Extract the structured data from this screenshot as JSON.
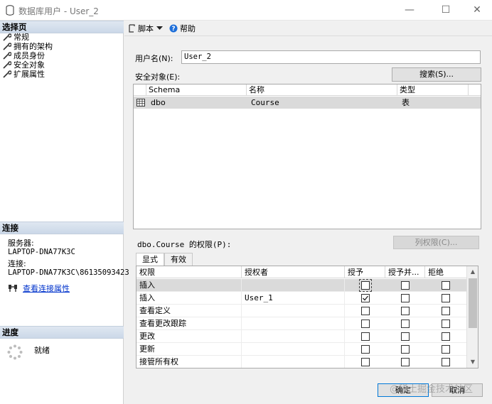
{
  "window": {
    "title": "数据库用户 - User_2",
    "min_icon": "—",
    "max_icon": "☐",
    "close_icon": "✕"
  },
  "left": {
    "select_page_header": "选择页",
    "pages": [
      "常规",
      "拥有的架构",
      "成员身份",
      "安全对象",
      "扩展属性"
    ],
    "connection_header": "连接",
    "server_label": "服务器:",
    "server_value": "LAPTOP-DNA77K3C",
    "connection_label": "连接:",
    "connection_value": "LAPTOP-DNA77K3C\\86135093423",
    "view_connection_link": "查看连接属性",
    "progress_header": "进度",
    "progress_status": "就绪"
  },
  "toolbar": {
    "script_label": "脚本",
    "help_label": "帮助"
  },
  "main": {
    "username_label": "用户名(N):",
    "username_value": "User_2",
    "securables_label": "安全对象(E):",
    "search_button": "搜索(S)...",
    "securables_columns": [
      "Schema",
      "名称",
      "类型"
    ],
    "securables_rows": [
      {
        "schema": "dbo",
        "name": "Course",
        "type": "表"
      }
    ],
    "permissions_label": "dbo.Course 的权限(P):",
    "column_permissions_button": "列权限(C)...",
    "tabs": [
      "显式",
      "有效"
    ],
    "perm_columns": [
      "权限",
      "授权者",
      "授予",
      "授予并...",
      "拒绝"
    ],
    "perm_rows": [
      {
        "permission": "插入",
        "grantor": "",
        "grant": false,
        "with_grant": false,
        "deny": false
      },
      {
        "permission": "插入",
        "grantor": "User_1",
        "grant": true,
        "with_grant": false,
        "deny": false
      },
      {
        "permission": "查看定义",
        "grantor": "",
        "grant": false,
        "with_grant": false,
        "deny": false
      },
      {
        "permission": "查看更改跟踪",
        "grantor": "",
        "grant": false,
        "with_grant": false,
        "deny": false
      },
      {
        "permission": "更改",
        "grantor": "",
        "grant": false,
        "with_grant": false,
        "deny": false
      },
      {
        "permission": "更新",
        "grantor": "",
        "grant": false,
        "with_grant": false,
        "deny": false
      },
      {
        "permission": "接管所有权",
        "grantor": "",
        "grant": false,
        "with_grant": false,
        "deny": false
      }
    ]
  },
  "footer": {
    "ok_button": "确定",
    "cancel_button": "取消"
  },
  "watermark_text": "@稀土掘金技术社区"
}
